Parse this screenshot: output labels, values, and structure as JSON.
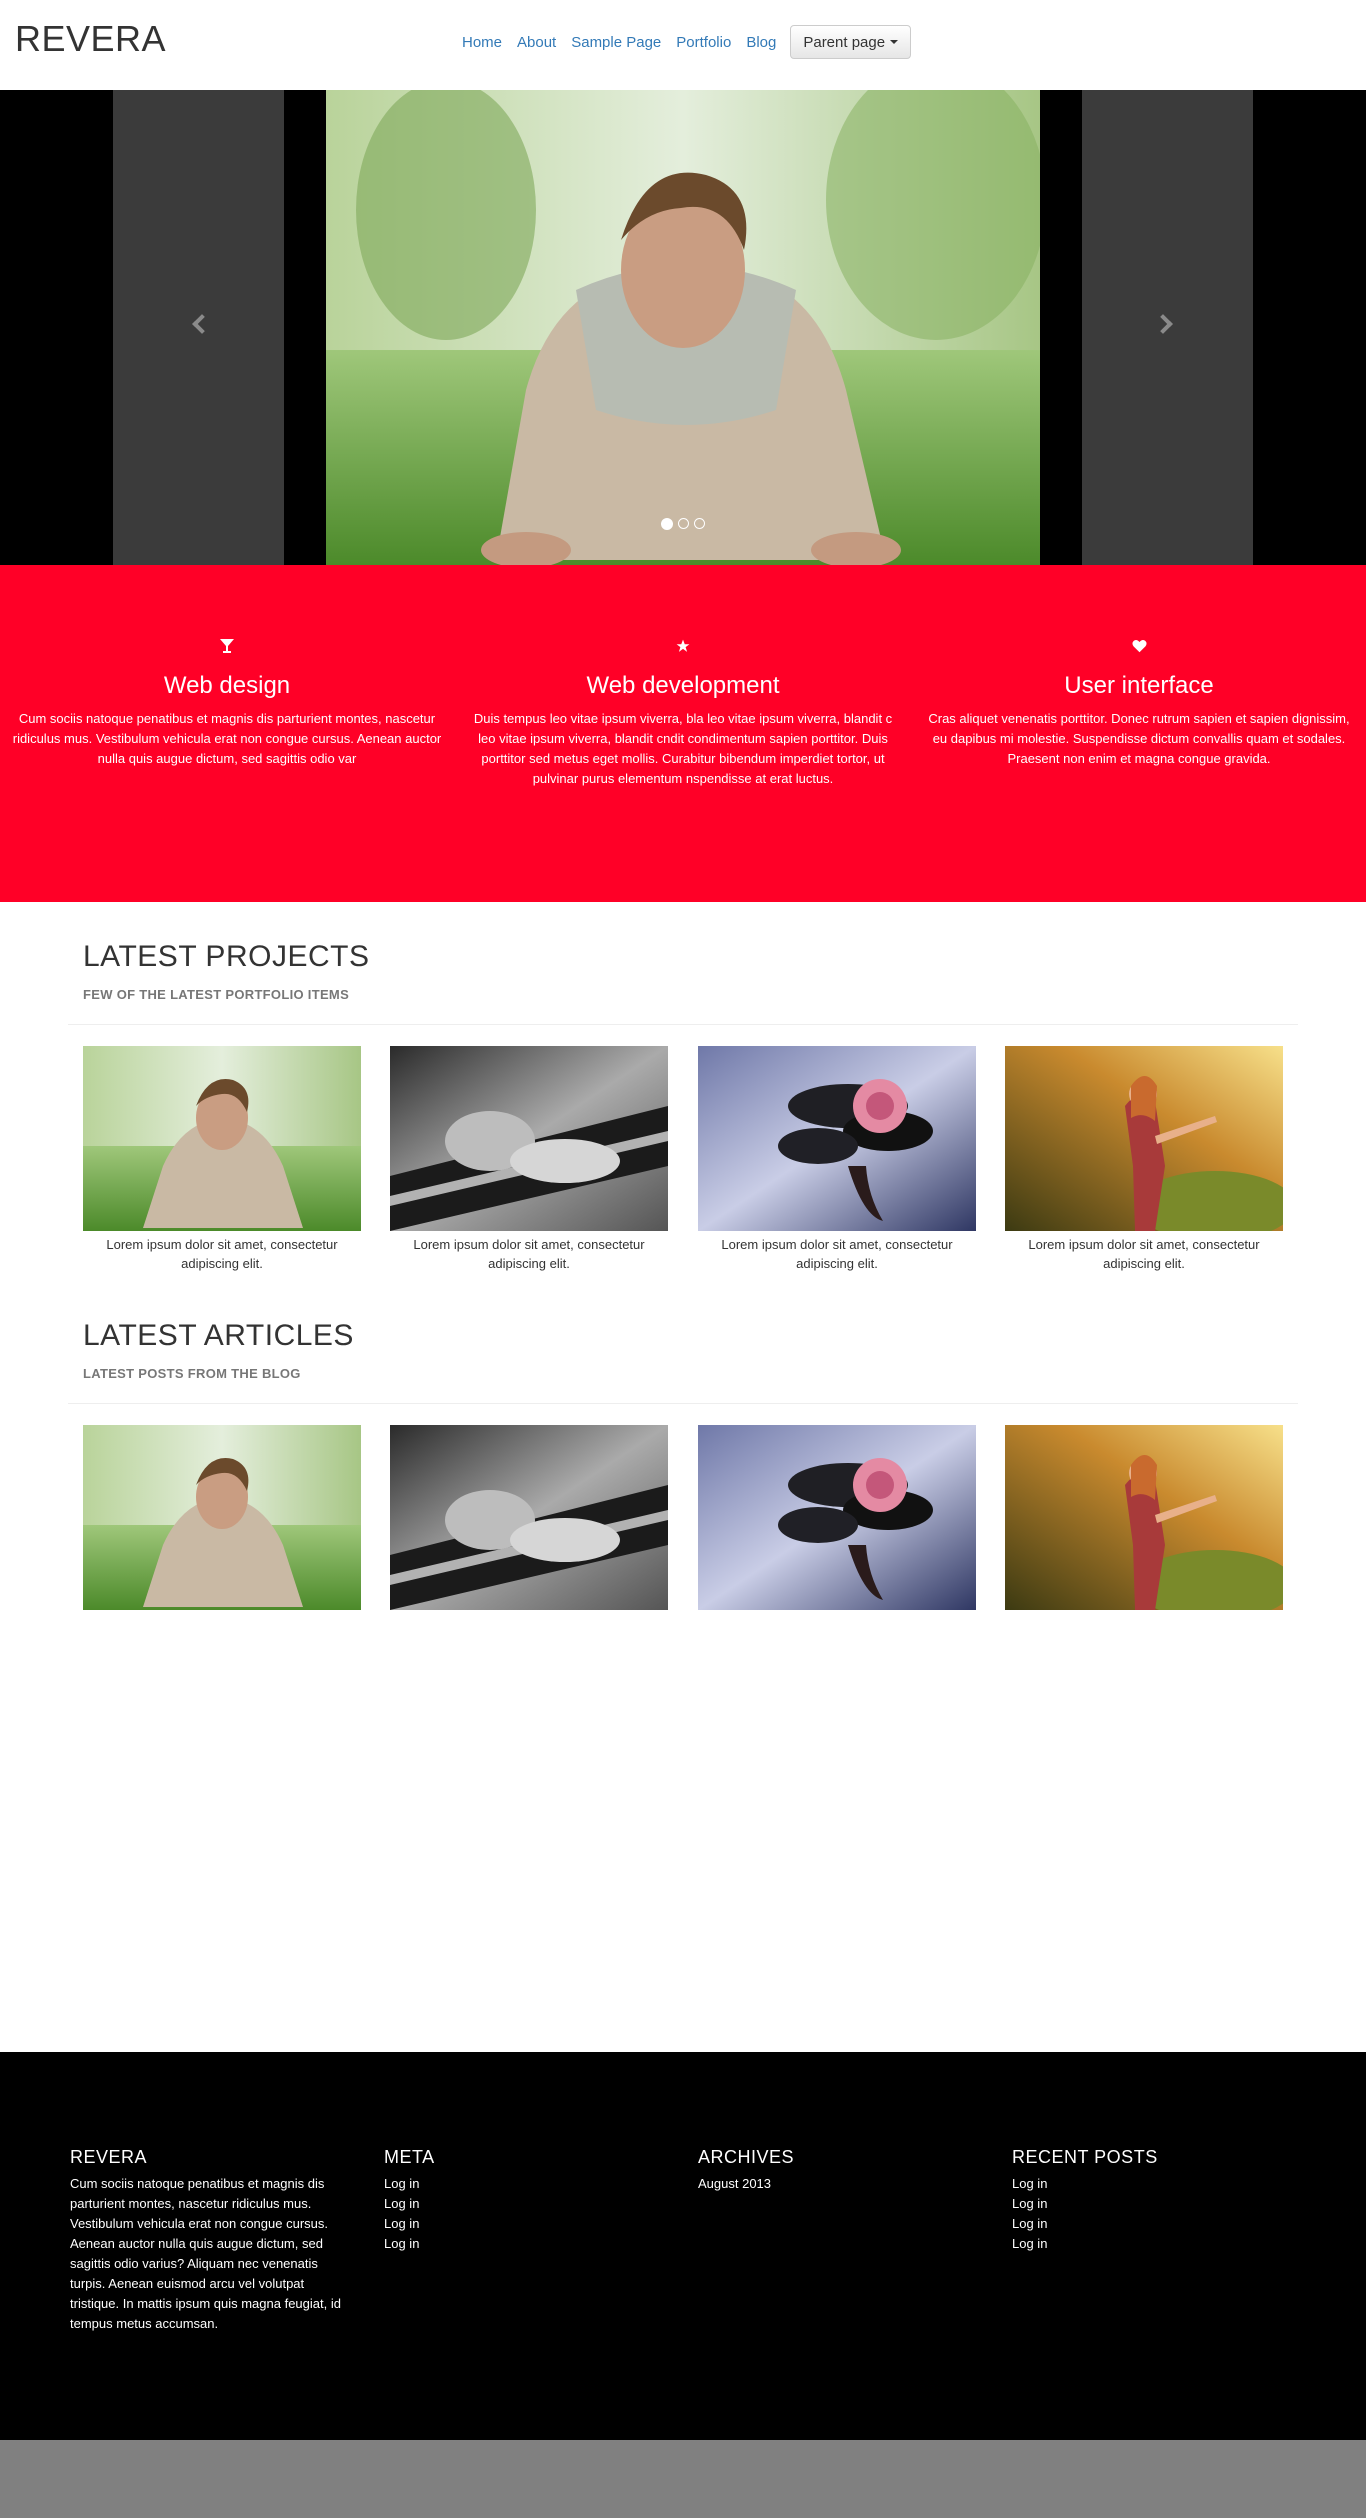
{
  "brand": "REVERA",
  "nav": {
    "items": [
      "Home",
      "About",
      "Sample Page",
      "Portfolio",
      "Blog"
    ],
    "dropdown_label": "Parent page"
  },
  "carousel": {
    "slide_count": 3,
    "active_index": 0
  },
  "features": [
    {
      "icon": "glass-icon",
      "title": "Web design",
      "text": "Cum sociis natoque penatibus et magnis dis parturient montes, nascetur ridiculus mus. Vestibulum vehicula erat non congue cursus. Aenean auctor nulla quis augue dictum, sed sagittis odio var"
    },
    {
      "icon": "star-icon",
      "title": "Web development",
      "text": "Duis tempus leo vitae ipsum viverra, bla leo vitae ipsum viverra, blandit c leo vitae ipsum viverra, blandit cndit condimentum sapien porttitor. Duis porttitor sed metus eget mollis. Curabitur bibendum imperdiet tortor, ut pulvinar purus elementum nspendisse at erat luctus."
    },
    {
      "icon": "heart-icon",
      "title": "User interface",
      "text": "Cras aliquet venenatis porttitor. Donec rutrum sapien et sapien dignissim, eu dapibus mi molestie. Suspendisse dictum convallis quam et sodales. Praesent non enim et magna congue gravida."
    }
  ],
  "projects": {
    "title": "LATEST PROJECTS",
    "subtitle": "FEW OF THE LATEST PORTFOLIO ITEMS",
    "items": [
      {
        "caption": "Lorem ipsum dolor sit amet, consectetur adipiscing elit."
      },
      {
        "caption": "Lorem ipsum dolor sit amet, consectetur adipiscing elit."
      },
      {
        "caption": "Lorem ipsum dolor sit amet, consectetur adipiscing elit."
      },
      {
        "caption": "Lorem ipsum dolor sit amet, consectetur adipiscing elit."
      }
    ]
  },
  "articles": {
    "title": "LATEST ARTICLES",
    "subtitle": "LATEST POSTS FROM THE BLOG"
  },
  "footer": {
    "about_title": "REVERA",
    "about_text": "Cum sociis natoque penatibus et magnis dis parturient montes, nascetur ridiculus mus. Vestibulum vehicula erat non congue cursus. Aenean auctor nulla quis augue dictum, sed sagittis odio varius? Aliquam nec venenatis turpis. Aenean euismod arcu vel volutpat tristique. In mattis ipsum quis magna feugiat, id tempus metus accumsan.",
    "meta_title": "META",
    "meta_links": [
      "Log in",
      "Log in",
      "Log in",
      "Log in"
    ],
    "archives_title": "ARCHIVES",
    "archives_links": [
      "August 2013"
    ],
    "recent_title": "RECENT POSTS",
    "recent_links": [
      "Log in",
      "Log in",
      "Log in",
      "Log in"
    ]
  },
  "colors": {
    "accent": "#ff0027",
    "link": "#337ab7",
    "footer_bg": "#000000",
    "bottom_bar": "#808080"
  }
}
